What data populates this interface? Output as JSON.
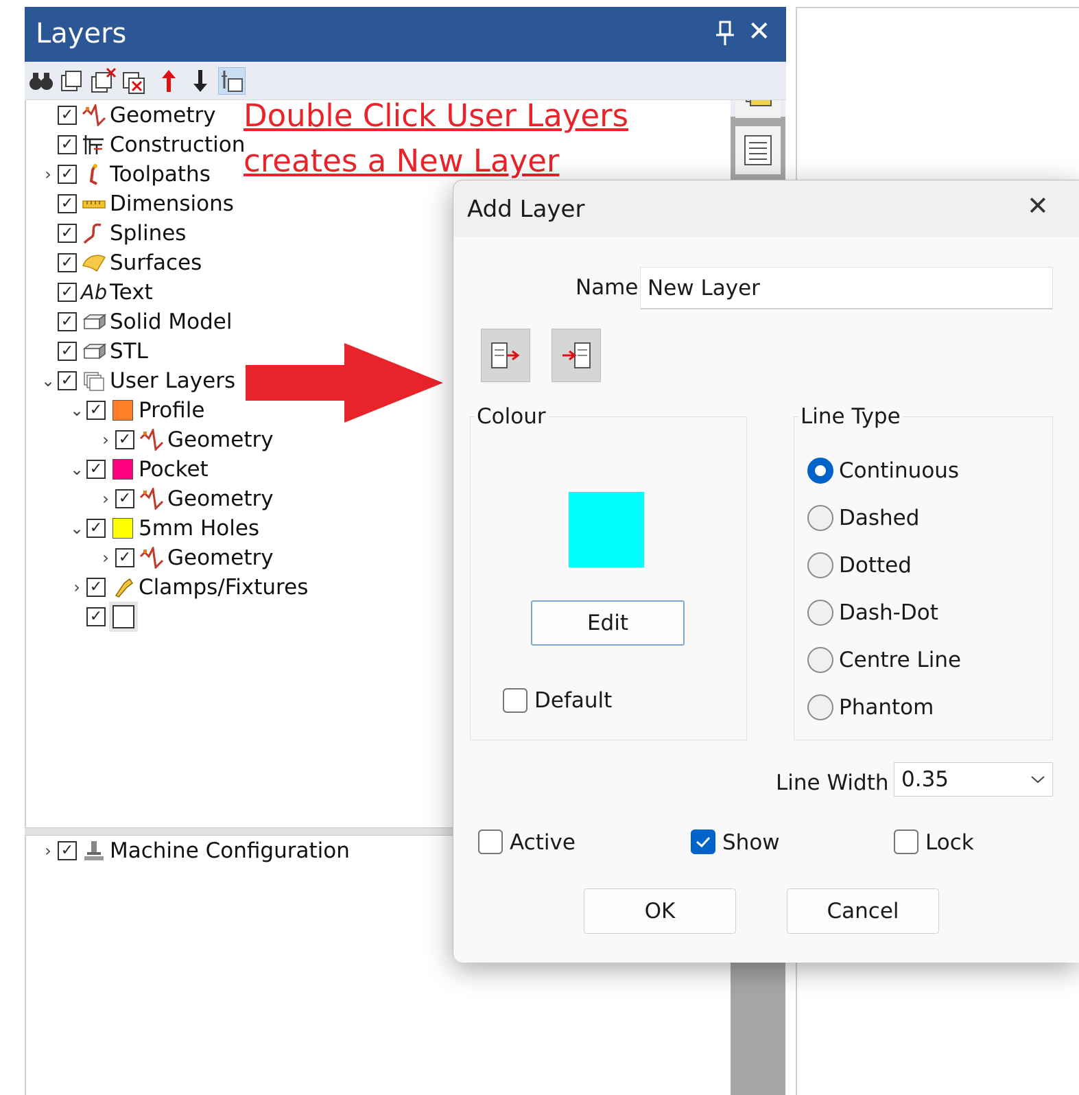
{
  "panel": {
    "title": "Layers",
    "pin_glyph": "⊥",
    "close_glyph": "✕",
    "toolbar_icons": [
      "binoculars-icon",
      "new-layer-icon",
      "delete-layer-icon",
      "delete-all-icon",
      "move-up-icon",
      "move-down-icon",
      "layer-properties-icon"
    ]
  },
  "tree": {
    "check": "✓",
    "expand_closed": "›",
    "expand_open": "⌄",
    "items": [
      {
        "label": "Geometry"
      },
      {
        "label": "Construction"
      },
      {
        "label": "Toolpaths"
      },
      {
        "label": "Dimensions"
      },
      {
        "label": "Splines"
      },
      {
        "label": "Surfaces"
      },
      {
        "label": "Text"
      },
      {
        "label": "Solid Model"
      },
      {
        "label": "STL"
      },
      {
        "label": "User Layers"
      },
      {
        "label": "Profile",
        "color": "#ff7f27"
      },
      {
        "label": "Geometry"
      },
      {
        "label": "Pocket",
        "color": "#ff0080"
      },
      {
        "label": "Geometry"
      },
      {
        "label": "5mm Holes",
        "color": "#ffff00"
      },
      {
        "label": "Geometry"
      },
      {
        "label": "Clamps/Fixtures"
      },
      {
        "label": "",
        "color": "#ffffff"
      }
    ],
    "text_icon_label": "Ab",
    "machine_config": "Machine Configuration"
  },
  "annotation": {
    "line1": "Double Click User Layers",
    "line2": "creates a New Layer",
    "color": "#e8232a"
  },
  "dialog": {
    "title": "Add Layer",
    "close_glyph": "✕",
    "name_label": "Name",
    "name_value": "New Layer",
    "colour_group": "Colour",
    "colour_value": "#00ffff",
    "edit_label": "Edit",
    "default_label": "Default",
    "line_type_group": "Line Type",
    "line_types": [
      "Continuous",
      "Dashed",
      "Dotted",
      "Dash-Dot",
      "Centre Line",
      "Phantom"
    ],
    "selected_line_type": "Continuous",
    "line_width_label": "Line Width",
    "line_width_value": "0.35",
    "active_label": "Active",
    "show_label": "Show",
    "lock_label": "Lock",
    "show_checked": true,
    "ok_label": "OK",
    "cancel_label": "Cancel",
    "accent": "#0063c9"
  }
}
